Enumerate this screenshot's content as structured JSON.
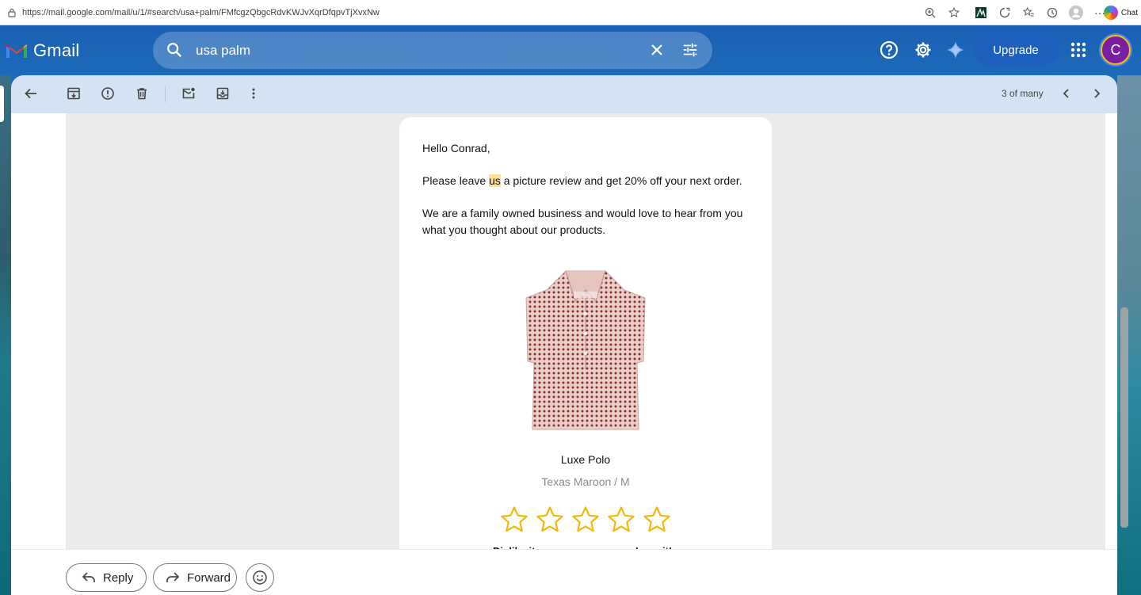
{
  "browser": {
    "url": "https://mail.google.com/mail/u/1/#search/usa+palm/FMfcgzQbgcRdvKWJvXqrDfqpvTjXvxNw",
    "chat_label": "Chat"
  },
  "header": {
    "app_name": "Gmail",
    "search_query": "usa palm",
    "upgrade_label": "Upgrade",
    "avatar_initial": "C",
    "accent": "#1a5fb4"
  },
  "toolbar": {
    "pagination": "3 of many"
  },
  "email": {
    "greeting": "Hello Conrad,",
    "line1_before": "Please leave ",
    "line1_highlight": "us",
    "line1_after": " a picture review and get 20% off your next order.",
    "line2a": "We are a family owned business and would love to hear from you",
    "line2b": "what you thought about our products.",
    "product_name": "Luxe Polo",
    "product_variant": "Texas Maroon / M",
    "rating_max": 5,
    "scale_left": "Dislike it",
    "scale_right": "Love it!"
  },
  "actions": {
    "reply_label": "Reply",
    "forward_label": "Forward"
  }
}
